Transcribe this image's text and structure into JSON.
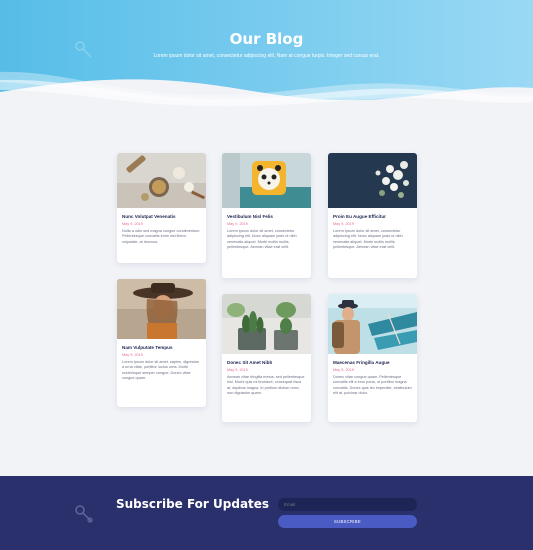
{
  "hero": {
    "title": "Our Blog",
    "subtitle": "Lorem ipsum dolor sit amet, consectetur adipiscing elit. Nam at congue turpis. Integer sed cursus erat."
  },
  "posts": [
    {
      "title": "Nunc Volutpat Venenatis",
      "date": "May 9, 2019",
      "excerpt": "Nulla a odio sed magna congue condimentum. Pellentesque convallis enim nisi libero vulputate, at rhoncus.",
      "image": "cooking-ingredients"
    },
    {
      "title": "Vestibulum Nisl Felis",
      "date": "May 9, 2019",
      "excerpt": "Lorem ipsum dolor sit amet, consectetur adipiscing elit. Nunc aliquam justo ut nibh venenatis aliquet. Morbi mollis mollis pellentesque. Aenean vitae erat velit.",
      "image": "panda-pillow"
    },
    {
      "title": "Proin Eu Augue Efficitur",
      "date": "May 9, 2019",
      "excerpt": "Lorem ipsum dolor sit amet, consectetur adipiscing elit. Nunc aliquam justo ut nibh venenatis aliquet. Morbi mollis mollis pellentesque. Aenean vitae erat velit.",
      "image": "white-flowers"
    },
    {
      "title": "Nam Vulputate Tempus",
      "date": "May 9, 2019",
      "excerpt": "Lorem ipsum dolor sit amet, sapien, dignissim a urna vitae, porttitor luctus urna. Morbi scelerisque semper congue. Donec vitae congue quam.",
      "image": "woman-hat"
    },
    {
      "title": "Donec Sit Amet Nibh",
      "date": "May 9, 2019",
      "excerpt": "Aenean vitae fringilla metus, sed pellentesque nisi. Morbi quis mi tincidunt, consequat risus at, dapibus magna. In pretium dictum nunc, non dignissim quam.",
      "image": "cactus-pots"
    },
    {
      "title": "Maecenas Fringilla Augue",
      "date": "May 9, 2019",
      "excerpt": "Donec vitae congue quam. Pellentesque convallis elit a eros porta, ut porttitor magna convallis. Donec quis leo imperdiet, vestibulum elit at, pulvinar dolor.",
      "image": "traveler-boats"
    }
  ],
  "subscribe": {
    "title": "Subscribe For Updates",
    "email_placeholder": "Email",
    "button_label": "SUBSCRIBE"
  },
  "colors": {
    "hero_gradient_start": "#5cc2ea",
    "hero_gradient_end": "#8fd5f3",
    "subscribe_bg": "#29306b",
    "button": "#4a5bc4",
    "date_accent": "#e86a8c"
  }
}
